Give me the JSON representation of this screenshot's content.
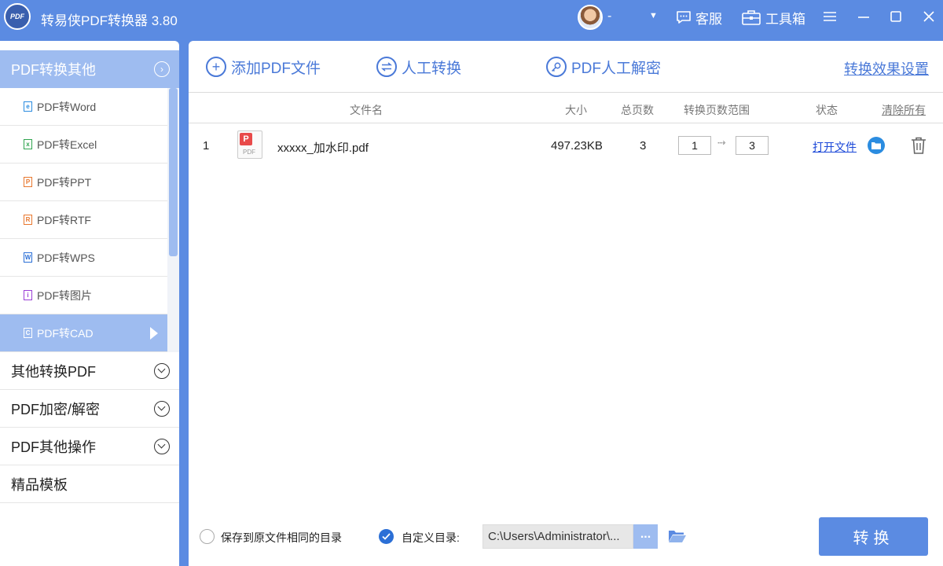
{
  "app": {
    "logo_text": "PDF",
    "title": "转易侠PDF转换器 3.80",
    "username": "-",
    "caret": "▼"
  },
  "titlebar": {
    "service_label": "客服",
    "toolbox_label": "工具箱"
  },
  "sidebar": {
    "section_label": "PDF转换其他",
    "items": [
      {
        "label": "PDF转Word",
        "icon": "word-file-icon",
        "icon_color": "#2b8ce0",
        "glyph": "e"
      },
      {
        "label": "PDF转Excel",
        "icon": "excel-file-icon",
        "icon_color": "#2fa44f",
        "glyph": "x"
      },
      {
        "label": "PDF转PPT",
        "icon": "ppt-file-icon",
        "icon_color": "#e8772e",
        "glyph": "P"
      },
      {
        "label": "PDF转RTF",
        "icon": "rtf-file-icon",
        "icon_color": "#e8772e",
        "glyph": "R"
      },
      {
        "label": "PDF转WPS",
        "icon": "wps-file-icon",
        "icon_color": "#2b6fd6",
        "glyph": "W"
      },
      {
        "label": "PDF转图片",
        "icon": "image-file-icon",
        "icon_color": "#9b3fd6",
        "glyph": "i"
      },
      {
        "label": "PDF转CAD",
        "icon": "cad-file-icon",
        "icon_color": "#ffffff",
        "glyph": "C",
        "active": true
      }
    ],
    "groups": [
      {
        "label": "其他转换PDF"
      },
      {
        "label": "PDF加密/解密"
      },
      {
        "label": "PDF其他操作"
      },
      {
        "label": "精品模板"
      }
    ]
  },
  "toolbar": {
    "add_label": "添加PDF文件",
    "manual_label": "人工转换",
    "decrypt_label": "PDF人工解密",
    "settings_label": "转换效果设置"
  },
  "table": {
    "headers": {
      "name": "文件名",
      "size": "大小",
      "pages": "总页数",
      "range": "转换页数范围",
      "status": "状态",
      "clear": "清除所有"
    },
    "rows": [
      {
        "index": "1",
        "name": "xxxxx_加水印.pdf",
        "size": "497.23KB",
        "pages": "3",
        "from": "1",
        "to": "3",
        "open_label": "打开文件"
      }
    ]
  },
  "bottom": {
    "same_dir_label": "保存到原文件相同的目录",
    "custom_dir_label": "自定义目录:",
    "path": "C:\\Users\\Administrator\\...",
    "browse_label": "...",
    "convert_label": "转换"
  },
  "colors": {
    "primary": "#5b8be2",
    "accent_light": "#9ebcf0",
    "link": "#1a47d8",
    "toolbar_text": "#4a79d8"
  }
}
